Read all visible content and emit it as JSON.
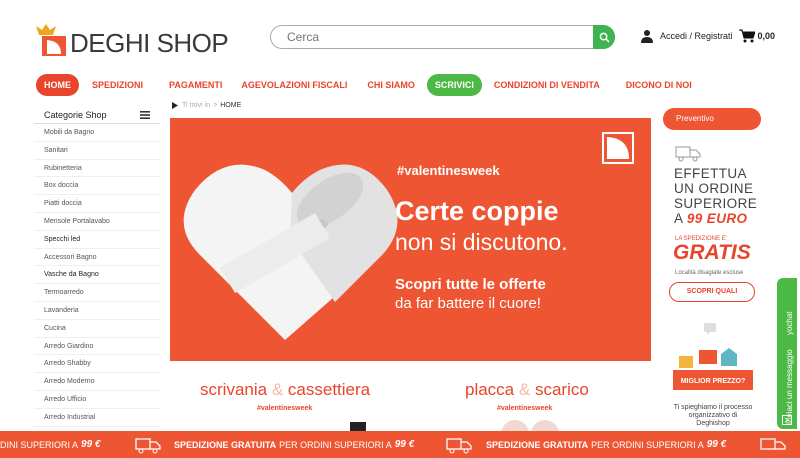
{
  "header": {
    "logo_text": "DEGHI SHOP",
    "search": {
      "placeholder": "Cerca"
    },
    "account_label": "Accedi / Registrati",
    "cart_total": "0,00"
  },
  "nav": {
    "items": [
      {
        "label": "HOME"
      },
      {
        "label": "SPEDIZIONI"
      },
      {
        "label": "PAGAMENTI"
      },
      {
        "label": "AGEVOLAZIONI FISCALI"
      },
      {
        "label": "CHI SIAMO"
      },
      {
        "label": "SCRIVICI"
      },
      {
        "label": "CONDIZIONI DI VENDITA"
      },
      {
        "label": "DICONO DI NOI"
      }
    ]
  },
  "breadcrumb": {
    "prefix": "Ti trovi in",
    "sep": ">",
    "current": "HOME"
  },
  "sidebar": {
    "title": "Categorie Shop",
    "items": [
      "Mobili da Bagno",
      "Sanitari",
      "Rubinetteria",
      "Box doccia",
      "Piatti doccia",
      "Mensole Portalavabo",
      "Specchi led",
      "Accessori Bagno",
      "Vasche da Bagno",
      "Termoarredo",
      "Lavanderia",
      "Cucina",
      "Arredo Giardino",
      "Arredo Shabby",
      "Arredo Moderno",
      "Arredo Ufficio",
      "Arredo Industrial"
    ]
  },
  "hero": {
    "tag": "#valentinesweek",
    "headline": "Certe coppie",
    "headline2": "non si discutono.",
    "cta_bold": "Scopri tutte le offerte",
    "cta_light": "da far battere il cuore!"
  },
  "products": [
    {
      "word1": "scrivania",
      "amp": "&",
      "word2": "cassettiera",
      "sub": "#valentinesweek"
    },
    {
      "word1": "placca",
      "amp": "&",
      "word2": "scarico",
      "sub": "#valentinesweek"
    }
  ],
  "right": {
    "preventivo": "Preventivo",
    "promo": {
      "l1": "EFFETTUA",
      "l2": "UN ORDINE",
      "l3": "SUPERIORE",
      "l4_a": "A",
      "l4_b": "99 EURO",
      "small": "LA SPEDIZIONE E'",
      "gratis": "GRATIS",
      "note": "Località disagiate escluse",
      "button": "SCOPRI QUALI"
    },
    "best_price_badge": "MIGLIOR PREZZO?",
    "best_price_text": "Ti spieghiamo il processo organizzativo di Deghishop"
  },
  "side_tab": {
    "brand": "yochat",
    "text": "Inviaci un messaggio"
  },
  "bottom_banner": {
    "seg0_rest": "DINI SUPERIORI A",
    "amount": "99 €",
    "bold": "SPEDIZIONE GRATUITA",
    "rest": "PER ORDINI SUPERIORI A"
  },
  "colors": {
    "brand_orange": "#ee5533",
    "accent_green": "#4cb846"
  }
}
